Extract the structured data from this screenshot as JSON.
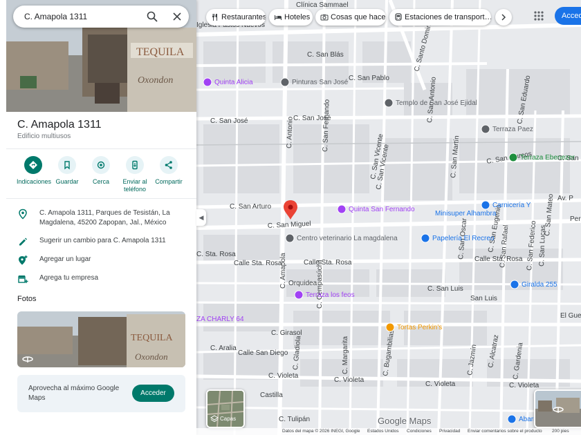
{
  "search": {
    "query": "C. Amapola 1311"
  },
  "place": {
    "title": "C. Amapola 1311",
    "category": "Edificio multiusos"
  },
  "actions": [
    {
      "label": "Indicaciones",
      "icon": "directions-icon"
    },
    {
      "label": "Guardar",
      "icon": "bookmark-icon"
    },
    {
      "label": "Cerca",
      "icon": "nearby-icon"
    },
    {
      "label": "Enviar al teléfono",
      "icon": "send-to-phone-icon"
    },
    {
      "label": "Compartir",
      "icon": "share-icon"
    }
  ],
  "info": {
    "address": "C. Amapola 1311, Parques de Tesistán, La Magdalena, 45200 Zapopan, Jal., México",
    "suggest_edit": "Sugerir un cambio para C. Amapola 1311",
    "add_place": "Agregar un lugar",
    "add_business": "Agrega tu empresa"
  },
  "photos": {
    "heading": "Fotos",
    "sign_text": "TEQUILA"
  },
  "promo": {
    "text": "Aprovecha al máximo Google Maps",
    "button": "Acceder"
  },
  "chips": [
    {
      "label": "Restaurantes",
      "icon": "restaurant-icon"
    },
    {
      "label": "Hoteles",
      "icon": "hotel-icon"
    },
    {
      "label": "Cosas que hacer",
      "icon": "camera-icon"
    },
    {
      "label": "Estaciones de transport…",
      "icon": "transit-icon"
    }
  ],
  "top_right": {
    "signin": "Acceder"
  },
  "map": {
    "streets": [
      "C. San Blás",
      "C. San Pablo",
      "Iglesia Pastos Nuevos",
      "C. San José",
      "C. San José",
      "C. San Arturo",
      "C. San Miguel",
      "Calle Sta. Rosa",
      "Calle Sta. Rosa",
      "Calle Sta. Rosa",
      "Orquidea",
      "C. San Luis",
      "C. Girasol",
      "C. Aralia",
      "C. Violeta",
      "C. Violeta",
      "C. Violeta",
      "C. Violeta",
      "Calle San Diego",
      "Castilla",
      "C. Tulipán",
      "C. Sta. Rosa",
      "Perla",
      "Av. P",
      "C. Antonio",
      "C. San Fernando",
      "C. San Vicente",
      "C. San Martín",
      "C. Amapola",
      "C. Cempasúchil",
      "C. Gladiola",
      "C. Margarita",
      "C. Bugambilias",
      "C. Jazmín",
      "C. Alcatraz",
      "C. Gardenia",
      "C. San Oscar",
      "C. San Eugenio",
      "C. San Federico",
      "C. San Rafael",
      "C. San Lucas",
      "C. San Mateo",
      "C. San Antonio",
      "C. San Vicente",
      "C. San Eduardo",
      "C. San Marcos",
      "C. Santo Domingo",
      "C. San Marcos",
      "San Luis"
    ],
    "pois": [
      "Clínica Sammael",
      "Quinta Alicia",
      "Pinturas San José",
      "Templo de San José Ejidal",
      "Terraza Paez",
      "Terraza Ebenezer",
      "Quinta San Fernando",
      "Carnicería Y",
      "Minisuper Alhambra",
      "Centro veterinario La magdalena",
      "Papelería El Recreo",
      "Terraza los feos",
      "ZA CHARLY 64",
      "Tortas Perkin's",
      "Giralda 255",
      "El Guero A Carr. Co",
      "Abarrotes Los Pinos"
    ],
    "layers_label": "Capas",
    "google_logo": "Google Maps"
  },
  "footer": [
    "Datos del mapa © 2026 INEGI, Google",
    "Estados Unidos",
    "Condiciones",
    "Privacidad",
    "Enviar comentarios sobre el producto",
    "200 pies"
  ],
  "colors": {
    "accent": "#00796b",
    "blue": "#1a73e8",
    "pin": "#ea4335",
    "poi_purple": "#a142f4",
    "poi_blue": "#1a73e8",
    "poi_green": "#1e8e3e",
    "poi_orange": "#f29900"
  }
}
